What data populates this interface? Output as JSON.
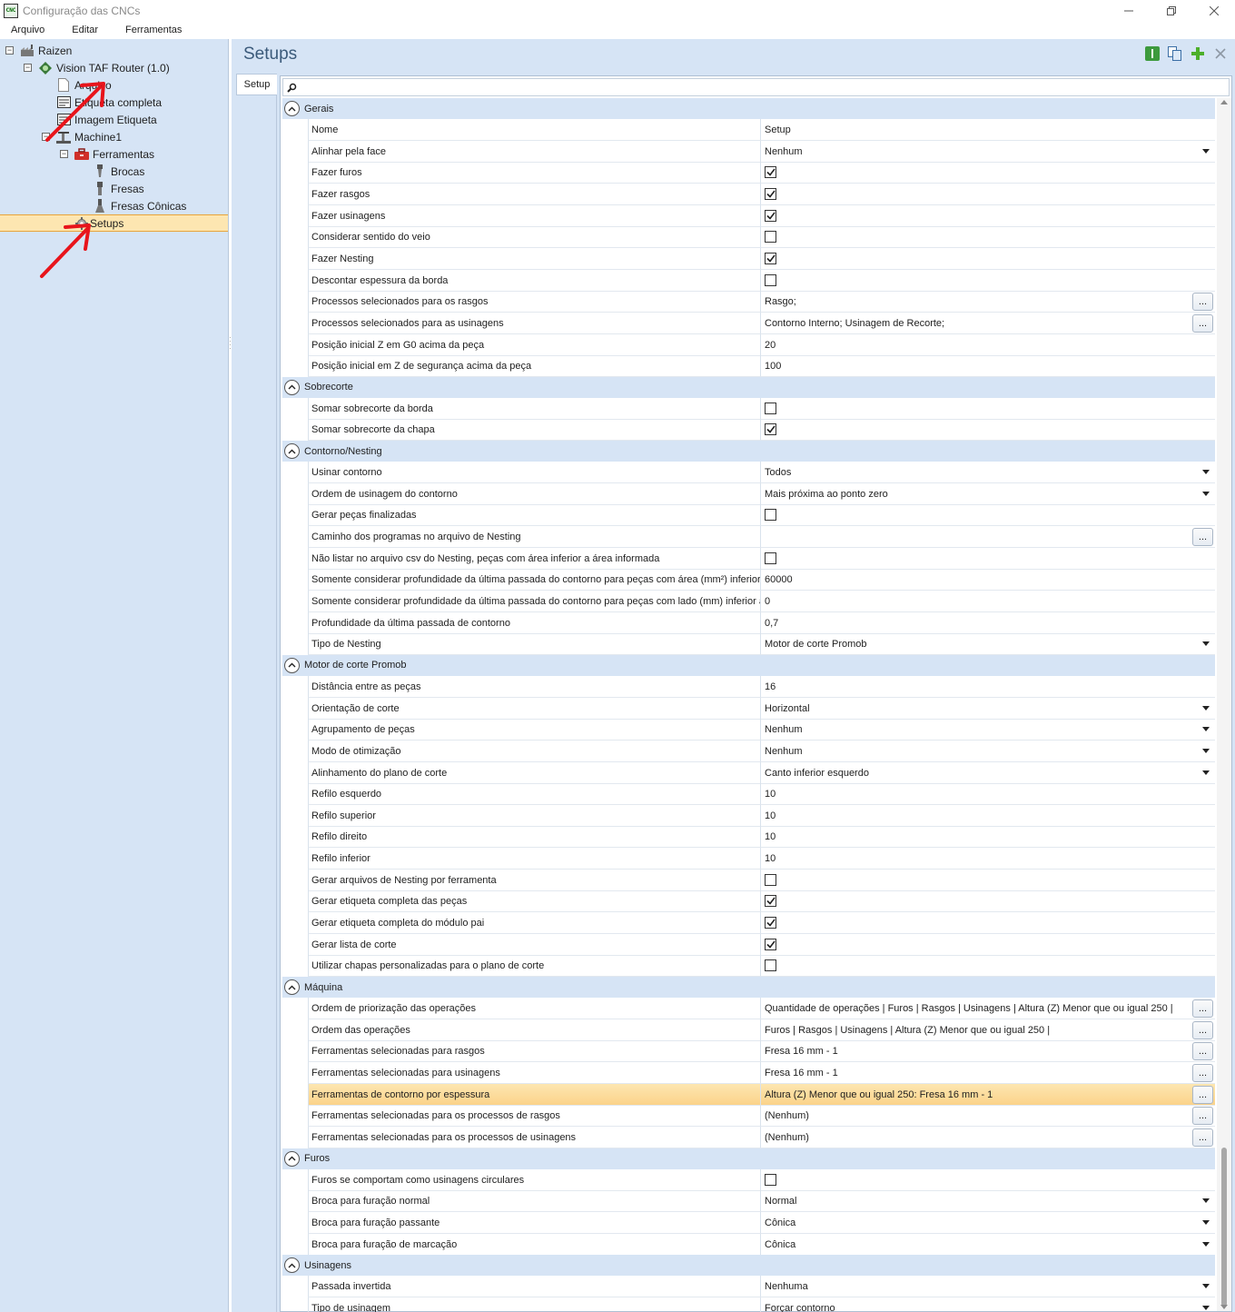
{
  "window": {
    "title": "Configuração das CNCs",
    "icon_text": "CNC"
  },
  "menu": [
    "Arquivo",
    "Editar",
    "Ferramentas"
  ],
  "tree": {
    "root": "Raizen",
    "machine_model": "Vision TAF Router (1.0)",
    "arquivo": "Arquivo",
    "etiqueta_completa": "Etiqueta completa",
    "imagem_etiqueta": "Imagem Etiqueta",
    "machine": "Machine1",
    "ferramentas": "Ferramentas",
    "brocas": "Brocas",
    "fresas": "Fresas",
    "fresas_conicas": "Fresas Cônicas",
    "setups": "Setups"
  },
  "panel": {
    "title": "Setups",
    "tab": "Setup"
  },
  "grid": {
    "categories": [
      {
        "label": "Gerais",
        "rows": [
          {
            "name": "Nome",
            "type": "text",
            "value": "Setup"
          },
          {
            "name": "Alinhar pela face",
            "type": "dropdown",
            "value": "Nenhum"
          },
          {
            "name": "Fazer furos",
            "type": "checkbox",
            "checked": true
          },
          {
            "name": "Fazer rasgos",
            "type": "checkbox",
            "checked": true
          },
          {
            "name": "Fazer usinagens",
            "type": "checkbox",
            "checked": true
          },
          {
            "name": "Considerar sentido do veio",
            "type": "checkbox",
            "checked": false
          },
          {
            "name": "Fazer Nesting",
            "type": "checkbox",
            "checked": true
          },
          {
            "name": "Descontar espessura da borda",
            "type": "checkbox",
            "checked": false
          },
          {
            "name": "Processos selecionados para os rasgos",
            "type": "ellipsis",
            "value": "Rasgo;"
          },
          {
            "name": "Processos selecionados para as usinagens",
            "type": "ellipsis",
            "value": "Contorno Interno; Usinagem de Recorte;"
          },
          {
            "name": "Posição inicial Z em G0 acima da peça",
            "type": "text",
            "value": "20"
          },
          {
            "name": "Posição inicial em Z de segurança acima da peça",
            "type": "text",
            "value": "100"
          }
        ]
      },
      {
        "label": "Sobrecorte",
        "rows": [
          {
            "name": "Somar sobrecorte da borda",
            "type": "checkbox",
            "checked": false
          },
          {
            "name": "Somar sobrecorte da chapa",
            "type": "checkbox",
            "checked": true
          }
        ]
      },
      {
        "label": "Contorno/Nesting",
        "rows": [
          {
            "name": "Usinar contorno",
            "type": "dropdown",
            "value": "Todos"
          },
          {
            "name": "Ordem de usinagem do contorno",
            "type": "dropdown",
            "value": "Mais próxima ao ponto zero"
          },
          {
            "name": "Gerar peças finalizadas",
            "type": "checkbox",
            "checked": false
          },
          {
            "name": "Caminho dos programas no arquivo de Nesting",
            "type": "ellipsis",
            "value": ""
          },
          {
            "name": "Não listar no arquivo csv do Nesting, peças com área inferior a área informada",
            "type": "checkbox",
            "checked": false
          },
          {
            "name": "Somente considerar profundidade da última passada do contorno para peças com área (mm²) inferior",
            "type": "text",
            "value": "60000"
          },
          {
            "name": "Somente considerar profundidade da última passada do contorno para peças com lado (mm) inferior a",
            "type": "text",
            "value": "0"
          },
          {
            "name": "Profundidade da última passada de contorno",
            "type": "text",
            "value": "0,7"
          },
          {
            "name": "Tipo de Nesting",
            "type": "dropdown",
            "value": "Motor de corte Promob"
          }
        ]
      },
      {
        "label": "Motor de corte Promob",
        "rows": [
          {
            "name": "Distância entre as peças",
            "type": "text",
            "value": "16"
          },
          {
            "name": "Orientação de corte",
            "type": "dropdown",
            "value": "Horizontal"
          },
          {
            "name": "Agrupamento de peças",
            "type": "dropdown",
            "value": "Nenhum"
          },
          {
            "name": "Modo de otimização",
            "type": "dropdown",
            "value": "Nenhum"
          },
          {
            "name": "Alinhamento do plano de corte",
            "type": "dropdown",
            "value": "Canto inferior esquerdo"
          },
          {
            "name": "Refilo esquerdo",
            "type": "text",
            "value": "10"
          },
          {
            "name": "Refilo superior",
            "type": "text",
            "value": "10"
          },
          {
            "name": "Refilo direito",
            "type": "text",
            "value": "10"
          },
          {
            "name": "Refilo inferior",
            "type": "text",
            "value": "10"
          },
          {
            "name": "Gerar arquivos de Nesting por ferramenta",
            "type": "checkbox",
            "checked": false
          },
          {
            "name": "Gerar etiqueta completa das peças",
            "type": "checkbox",
            "checked": true
          },
          {
            "name": "Gerar etiqueta completa do módulo pai",
            "type": "checkbox",
            "checked": true
          },
          {
            "name": "Gerar lista de corte",
            "type": "checkbox",
            "checked": true
          },
          {
            "name": "Utilizar chapas personalizadas para o plano de corte",
            "type": "checkbox",
            "checked": false
          }
        ]
      },
      {
        "label": "Máquina",
        "rows": [
          {
            "name": "Ordem de priorização das operações",
            "type": "ellipsis",
            "value": "Quantidade de operações | Furos | Rasgos | Usinagens | Altura (Z) Menor que ou igual 250 |"
          },
          {
            "name": "Ordem das operações",
            "type": "ellipsis",
            "value": "Furos | Rasgos | Usinagens | Altura (Z) Menor que ou igual 250 |"
          },
          {
            "name": "Ferramentas selecionadas para rasgos",
            "type": "ellipsis",
            "value": "Fresa 16 mm - 1"
          },
          {
            "name": "Ferramentas selecionadas para usinagens",
            "type": "ellipsis",
            "value": "Fresa 16 mm - 1"
          },
          {
            "name": "Ferramentas de contorno por espessura",
            "type": "ellipsis",
            "value": "Altura (Z) Menor que ou igual 250: Fresa 16 mm - 1",
            "highlighted": true
          },
          {
            "name": "Ferramentas selecionadas para os processos de rasgos",
            "type": "ellipsis",
            "value": "(Nenhum)"
          },
          {
            "name": "Ferramentas selecionadas para os processos de usinagens",
            "type": "ellipsis",
            "value": "(Nenhum)"
          }
        ]
      },
      {
        "label": "Furos",
        "rows": [
          {
            "name": "Furos se comportam como usinagens circulares",
            "type": "checkbox",
            "checked": false
          },
          {
            "name": "Broca para furação normal",
            "type": "dropdown",
            "value": "Normal"
          },
          {
            "name": "Broca para furação passante",
            "type": "dropdown",
            "value": "Cônica"
          },
          {
            "name": "Broca para furação de marcação",
            "type": "dropdown",
            "value": "Cônica"
          }
        ]
      },
      {
        "label": "Usinagens",
        "rows": [
          {
            "name": "Passada invertida",
            "type": "dropdown",
            "value": "Nenhuma"
          },
          {
            "name": "Tipo de usinagem",
            "type": "dropdown",
            "value": "Forçar contorno"
          }
        ]
      }
    ]
  },
  "colors": {
    "panel_bg": "#d6e4f5",
    "selection": "#fde6b1",
    "title_blue": "#3b5a7a",
    "annotation_red": "#e8141b"
  }
}
